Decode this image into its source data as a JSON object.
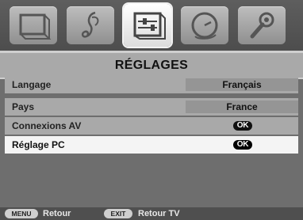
{
  "menu": {
    "title": "RÉGLAGES",
    "tabs": [
      {
        "icon": "picture-icon"
      },
      {
        "icon": "music-note-icon"
      },
      {
        "icon": "settings-sliders-icon",
        "active": true
      },
      {
        "icon": "clock-icon"
      },
      {
        "icon": "wrench-icon"
      }
    ],
    "rows": [
      {
        "label": "Langage",
        "value": "Français"
      },
      {
        "label": "Pays",
        "value": "France"
      },
      {
        "label": "Connexions AV",
        "value": "OK"
      },
      {
        "label": "Réglage PC",
        "value": "OK",
        "selected": true
      }
    ]
  },
  "footer": {
    "menu_key": "MENU",
    "menu_label": "Retour",
    "exit_key": "EXIT",
    "exit_label": "Retour TV"
  }
}
